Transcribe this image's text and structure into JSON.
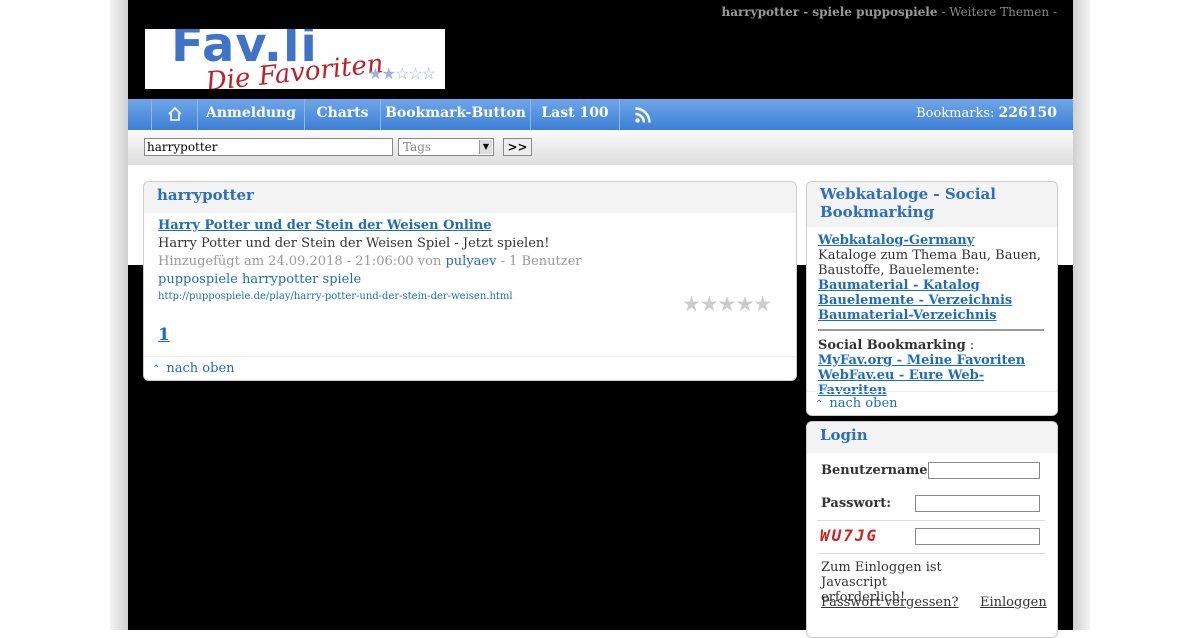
{
  "header": {
    "topline_bold": "harrypotter - spiele puppospiele",
    "topline_rest": "- Weitere Themen -",
    "logo_main": "Fav.li",
    "logo_sub": "Die Favoriten Liste"
  },
  "nav": {
    "items": [
      "Anmeldung",
      "Charts",
      "Bookmark-Button",
      "Last 100"
    ],
    "bookmarks_label": "Bookmarks:",
    "bookmarks_count": "226150"
  },
  "search": {
    "value": "harrypotter",
    "select_value": "Tags",
    "go_label": ">>"
  },
  "main": {
    "title": "harrypotter",
    "entry": {
      "title": "Harry Potter und der Stein der Weisen Online",
      "description": "Harry Potter und der Stein der Weisen Spiel - Jetzt spielen!",
      "added": "Hinzugefügt am 24.09.2018 - 21:06:00",
      "von": "von",
      "user": "pulyaev",
      "users_count": "- 1 Benutzer",
      "tags": "puppospiele harrypotter spiele",
      "url": "http://puppospiele.de/play/harry-potter-und-der-stein-der-weisen.html",
      "rating": 0
    },
    "page": "1",
    "to_top": "nach oben"
  },
  "sidebar": {
    "title": "Webkataloge - Social Bookmarking",
    "link1": "Webkatalog-Germany",
    "text1": "Kataloge zum Thema Bau, Bauen, Baustoffe, Bauelemente:",
    "link2": "Baumaterial - Katalog",
    "link3": "Bauelemente - Verzeichnis",
    "link4": "Baumaterial-Verzeichnis",
    "social_label": "Social Bookmarking",
    "social_colon": ":",
    "link5": "MyFav.org - Meine Favoriten",
    "link6": "WebFav.eu - Eure Web-Favoriten",
    "to_top": "nach oben"
  },
  "login": {
    "title": "Login",
    "username_label": "Benutzername:",
    "password_label": "Passwort:",
    "captcha": "WU7JG",
    "js_note": "Zum Einloggen ist Javascript erforderlich!",
    "forgot": "Passwort vergessen?",
    "submit": "Einloggen"
  },
  "colors": {
    "accent": "#1e6cc0",
    "nav": "#4a8ce0"
  }
}
